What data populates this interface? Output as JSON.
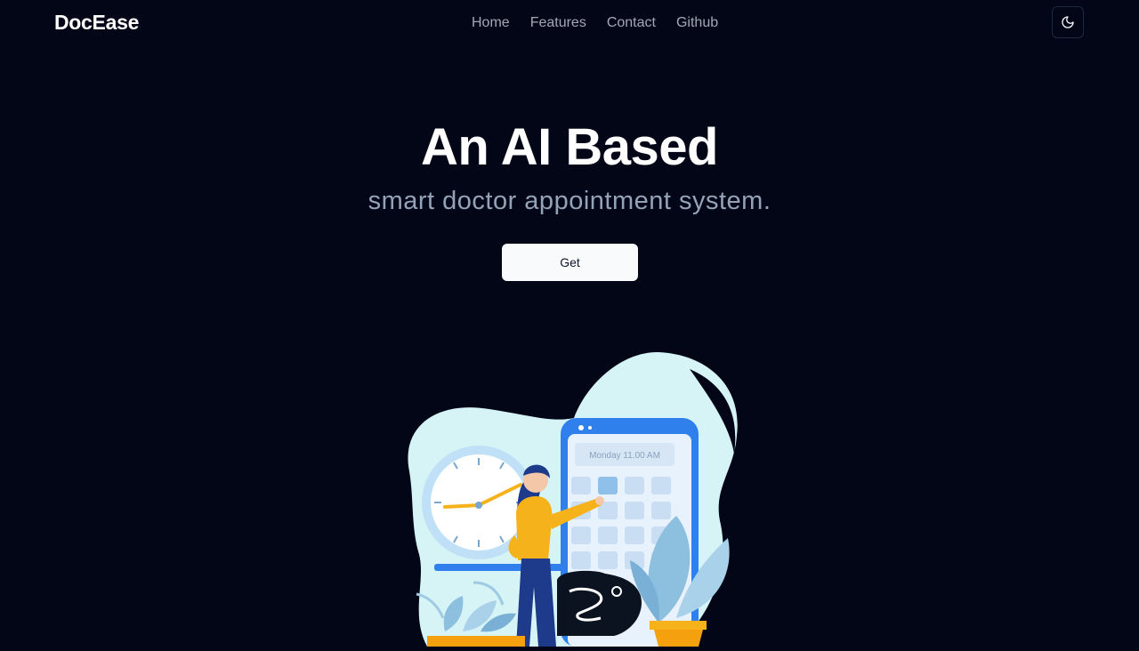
{
  "brand": {
    "name": "DocEase"
  },
  "nav": {
    "links": [
      "Home",
      "Features",
      "Contact",
      "Github"
    ]
  },
  "theme_toggle": {
    "icon": "moon-icon"
  },
  "hero": {
    "title": "An AI Based",
    "subtitle": "smart doctor appointment system.",
    "cta_label": "Get"
  },
  "illustration": {
    "calendar_label": "Monday 11.00 AM"
  },
  "colors": {
    "background": "#020617",
    "text": "#ffffff",
    "muted": "#94a3b8",
    "button_bg": "#f8fafc",
    "accent_blue": "#2f80ed",
    "accent_yellow": "#f5b21a"
  }
}
